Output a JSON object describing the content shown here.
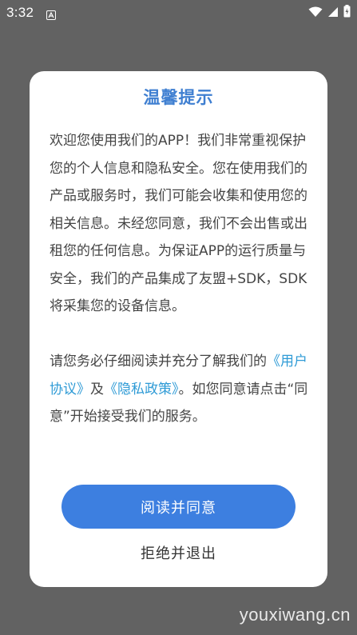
{
  "status_bar": {
    "time": "3:32"
  },
  "dialog": {
    "title": "温馨提示",
    "paragraph1": "欢迎您使用我们的APP！我们非常重视保护您的个人信息和隐私安全。您在使用我们的产品或服务时，我们可能会收集和使用您的相关信息。未经您同意，我们不会出售或出租您的任何信息。为保证APP的运行质量与安全，我们的产品集成了友盟+SDK，SDK将采集您的设备信息。",
    "paragraph2_pre": "请您务必仔细阅读并充分了解我们的",
    "user_agreement_link": "《用户协议》",
    "and_text": "及",
    "privacy_policy_link": "《隐私政策》",
    "paragraph2_post": "。如您同意请点击“同意”开始接受我们的服务。",
    "agree_label": "阅读并同意",
    "decline_label": "拒绝并退出"
  },
  "watermark": "youxiwang.cn",
  "colors": {
    "title": "#3f7fd1",
    "link": "#2f9bd6",
    "primary_button": "#3d7fe0",
    "overlay": "#626262"
  }
}
